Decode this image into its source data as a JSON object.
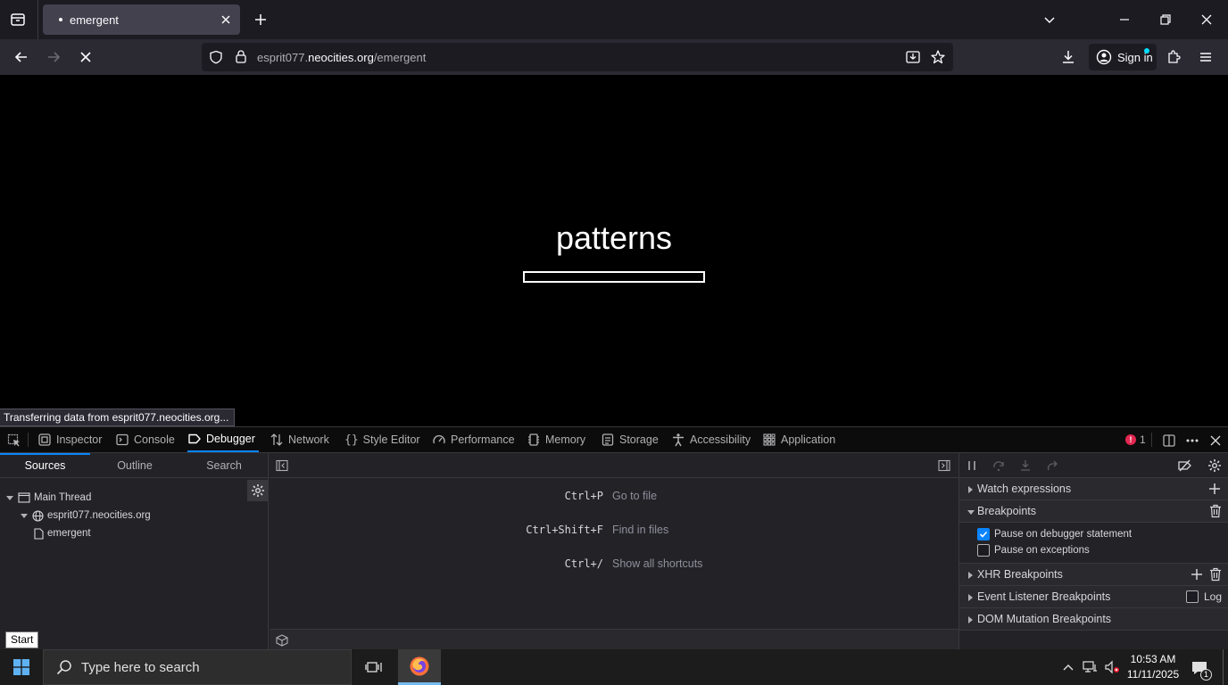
{
  "browser": {
    "tab_title": "emergent",
    "new_tab": "+",
    "url_host_prefix": "esprit077.",
    "url_host_domain": "neocities.org",
    "url_path": "/emergent",
    "sign_in_label": "Sign in"
  },
  "page": {
    "heading": "patterns",
    "progress": 0.0,
    "status_text": "Transferring data from esprit077.neocities.org..."
  },
  "devtools": {
    "tabs": [
      {
        "label": "Inspector",
        "icon": "inspector-icon"
      },
      {
        "label": "Console",
        "icon": "console-icon"
      },
      {
        "label": "Debugger",
        "icon": "debugger-icon",
        "active": true
      },
      {
        "label": "Network",
        "icon": "network-icon"
      },
      {
        "label": "Style Editor",
        "icon": "braces-icon"
      },
      {
        "label": "Performance",
        "icon": "gauge-icon"
      },
      {
        "label": "Memory",
        "icon": "chip-icon"
      },
      {
        "label": "Storage",
        "icon": "storage-icon"
      },
      {
        "label": "Accessibility",
        "icon": "accessibility-icon"
      },
      {
        "label": "Application",
        "icon": "grid-icon"
      }
    ],
    "error_count": "1",
    "sources": {
      "tabs": [
        "Sources",
        "Outline",
        "Search"
      ],
      "tree": {
        "thread": "Main Thread",
        "host": "esprit077.neocities.org",
        "file": "emergent"
      }
    },
    "editor": {
      "shortcuts": [
        {
          "keys": "Ctrl+P",
          "desc": "Go to file"
        },
        {
          "keys": "Ctrl+Shift+F",
          "desc": "Find in files"
        },
        {
          "keys": "Ctrl+/",
          "desc": "Show all shortcuts"
        }
      ]
    },
    "right": {
      "watch": "Watch expressions",
      "breakpoints": "Breakpoints",
      "pause_debugger": "Pause on debugger statement",
      "pause_exceptions": "Pause on exceptions",
      "xhr": "XHR Breakpoints",
      "event_listener": "Event Listener Breakpoints",
      "log": "Log",
      "dom_mutation": "DOM Mutation Breakpoints"
    }
  },
  "taskbar": {
    "start_tooltip": "Start",
    "search_placeholder": "Type here to search",
    "time": "10:53 AM",
    "date": "11/11/2025",
    "notification_count": "1"
  },
  "colors": {
    "accent": "#0a84ff",
    "error": "#e22850"
  }
}
